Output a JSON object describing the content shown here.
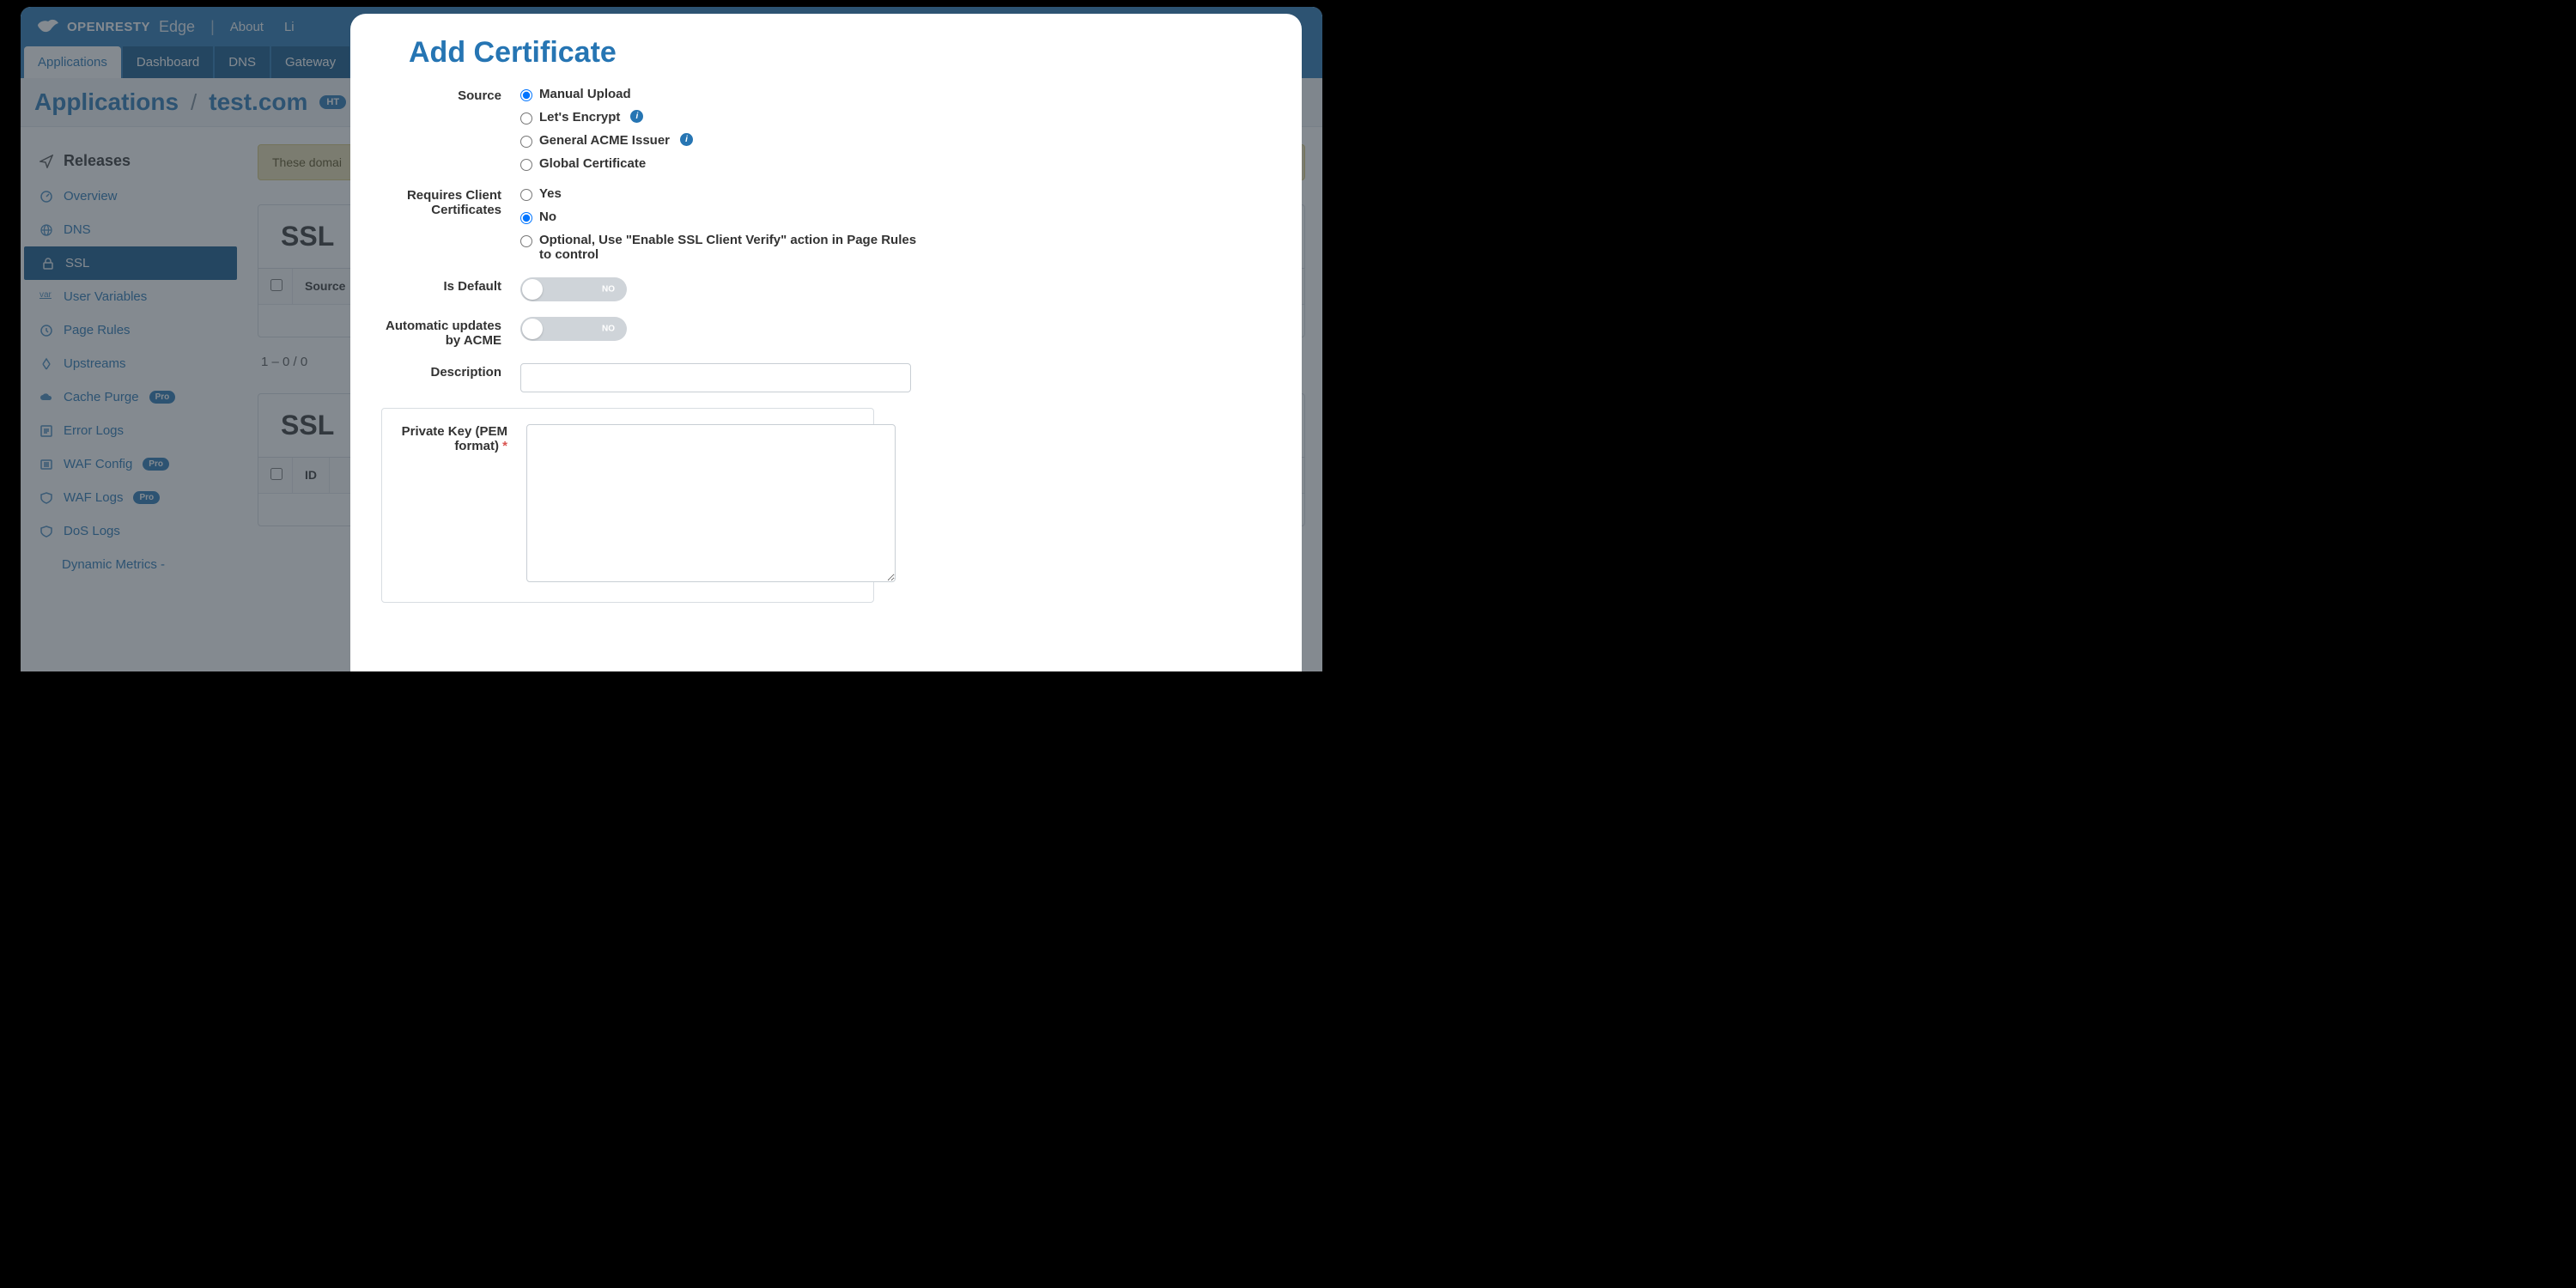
{
  "header": {
    "brand_main": "OPENRESTY",
    "brand_sub": "Edge",
    "links": [
      "About",
      "Li"
    ]
  },
  "tabs": {
    "items": [
      "Applications",
      "Dashboard",
      "DNS",
      "Gateway"
    ],
    "active_index": 0
  },
  "breadcrumb": {
    "root": "Applications",
    "current": "test.com",
    "badge": "HT"
  },
  "sidebar": {
    "heading": "Releases",
    "items": [
      {
        "label": "Overview",
        "icon": "gauge"
      },
      {
        "label": "DNS",
        "icon": "globe"
      },
      {
        "label": "SSL",
        "icon": "lock",
        "active": true
      },
      {
        "label": "User Variables",
        "icon": "var"
      },
      {
        "label": "Page Rules",
        "icon": "clock"
      },
      {
        "label": "Upstreams",
        "icon": "up"
      },
      {
        "label": "Cache Purge",
        "icon": "cloud",
        "pro": true
      },
      {
        "label": "Error Logs",
        "icon": "list"
      },
      {
        "label": "WAF Config",
        "icon": "shield",
        "pro": true
      },
      {
        "label": "WAF Logs",
        "icon": "shield-log",
        "pro": true
      },
      {
        "label": "DoS Logs",
        "icon": "shield-log"
      },
      {
        "label": "Dynamic Metrics -",
        "icon": "",
        "sub": true
      }
    ],
    "pro_label": "Pro"
  },
  "content": {
    "warning": "These domai",
    "section1_title": "SSL",
    "section2_title": "SSL",
    "col_source": "Source",
    "col_id": "ID",
    "pager": "1 – 0 / 0"
  },
  "modal": {
    "title": "Add Certificate",
    "source": {
      "label": "Source",
      "options": [
        {
          "label": "Manual Upload",
          "info": false
        },
        {
          "label": "Let's Encrypt",
          "info": true
        },
        {
          "label": "General ACME Issuer",
          "info": true
        },
        {
          "label": "Global Certificate",
          "info": false
        }
      ],
      "selected_index": 0
    },
    "requires_client": {
      "label": "Requires Client Certificates",
      "options": [
        {
          "label": "Yes"
        },
        {
          "label": "No"
        },
        {
          "label": "Optional, Use \"Enable SSL Client Verify\" action in Page Rules to control"
        }
      ],
      "selected_index": 1
    },
    "is_default": {
      "label": "Is Default",
      "value": false,
      "off_text": "NO"
    },
    "auto_acme": {
      "label": "Automatic updates by ACME",
      "value": false,
      "off_text": "NO"
    },
    "description": {
      "label": "Description",
      "value": ""
    },
    "private_key": {
      "label": "Private Key (PEM format)",
      "required": true,
      "value": ""
    }
  }
}
